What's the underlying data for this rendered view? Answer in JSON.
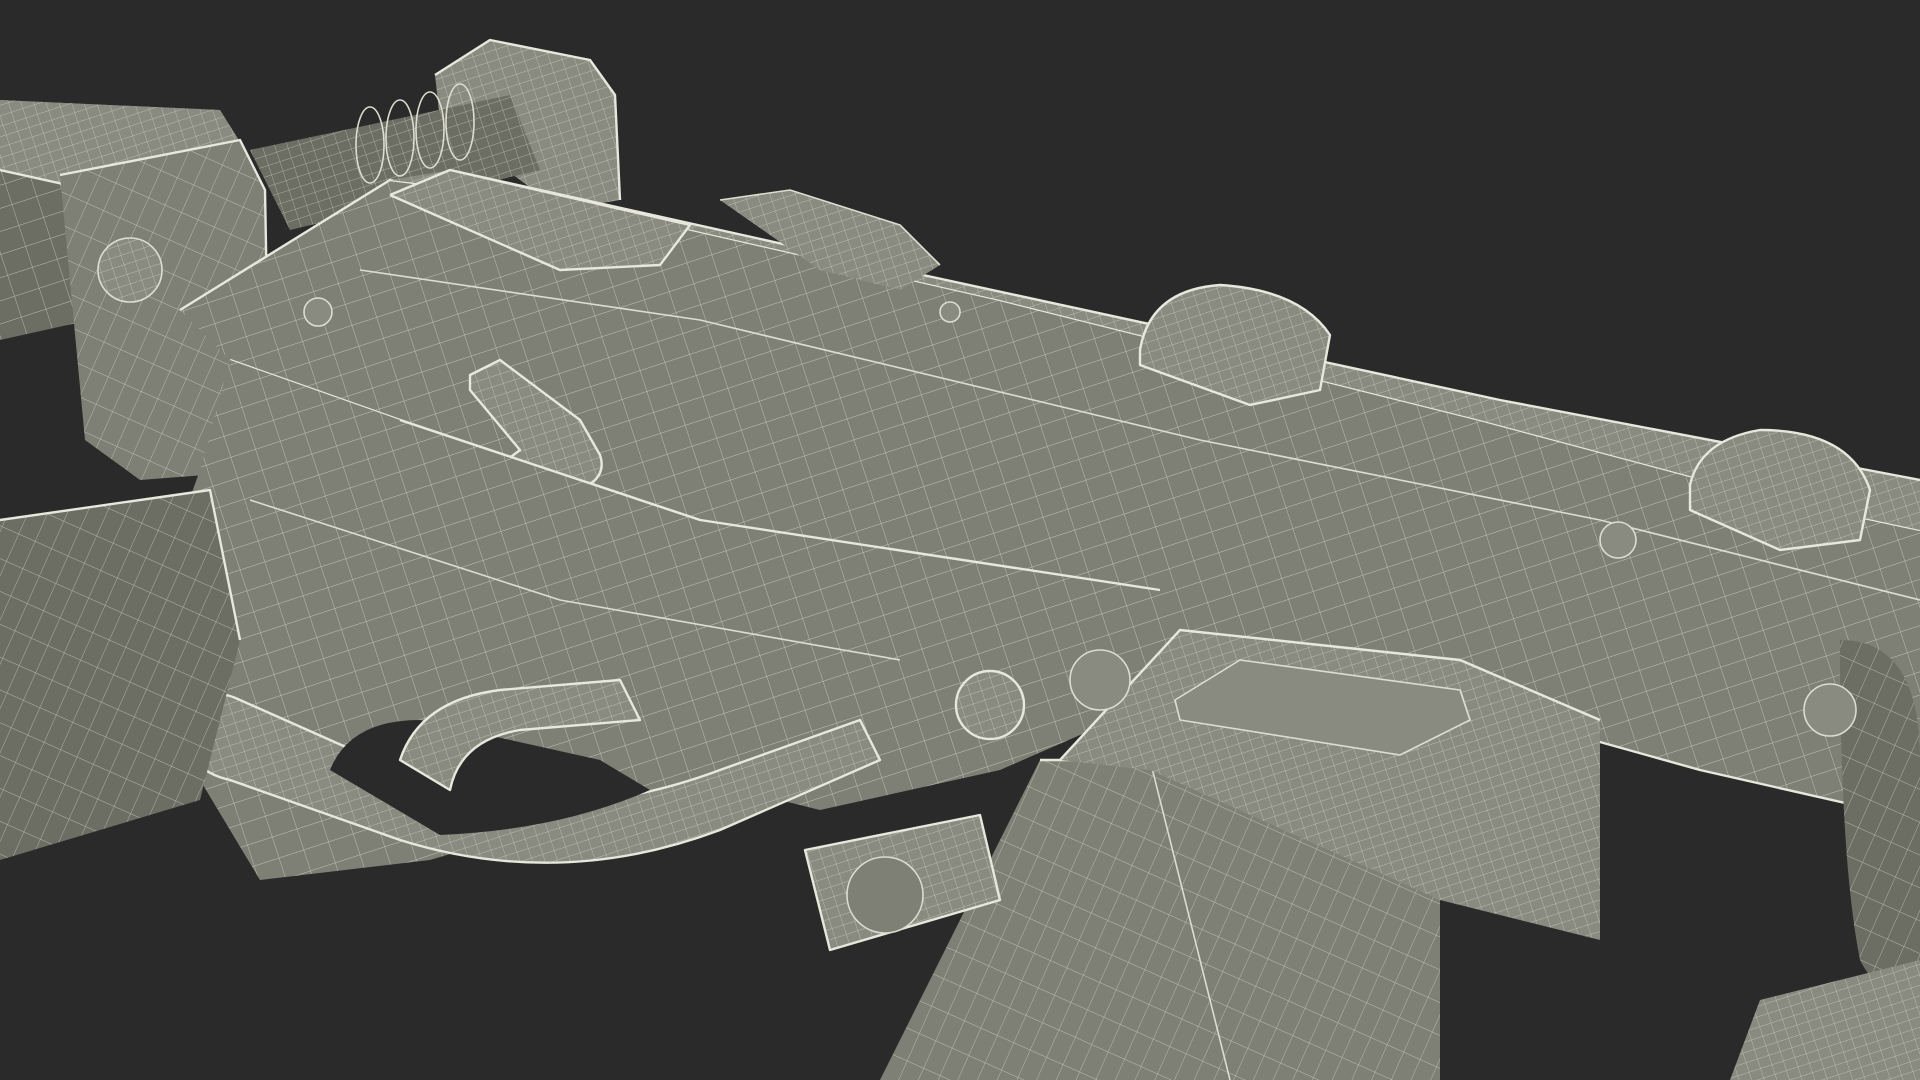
{
  "scene": {
    "subject": "rendered-model",
    "render_style": "wireframe-overlay",
    "background_color": "#2a2a2a",
    "surface_color": "#7f8075",
    "wire_color": "#dcdccf"
  }
}
